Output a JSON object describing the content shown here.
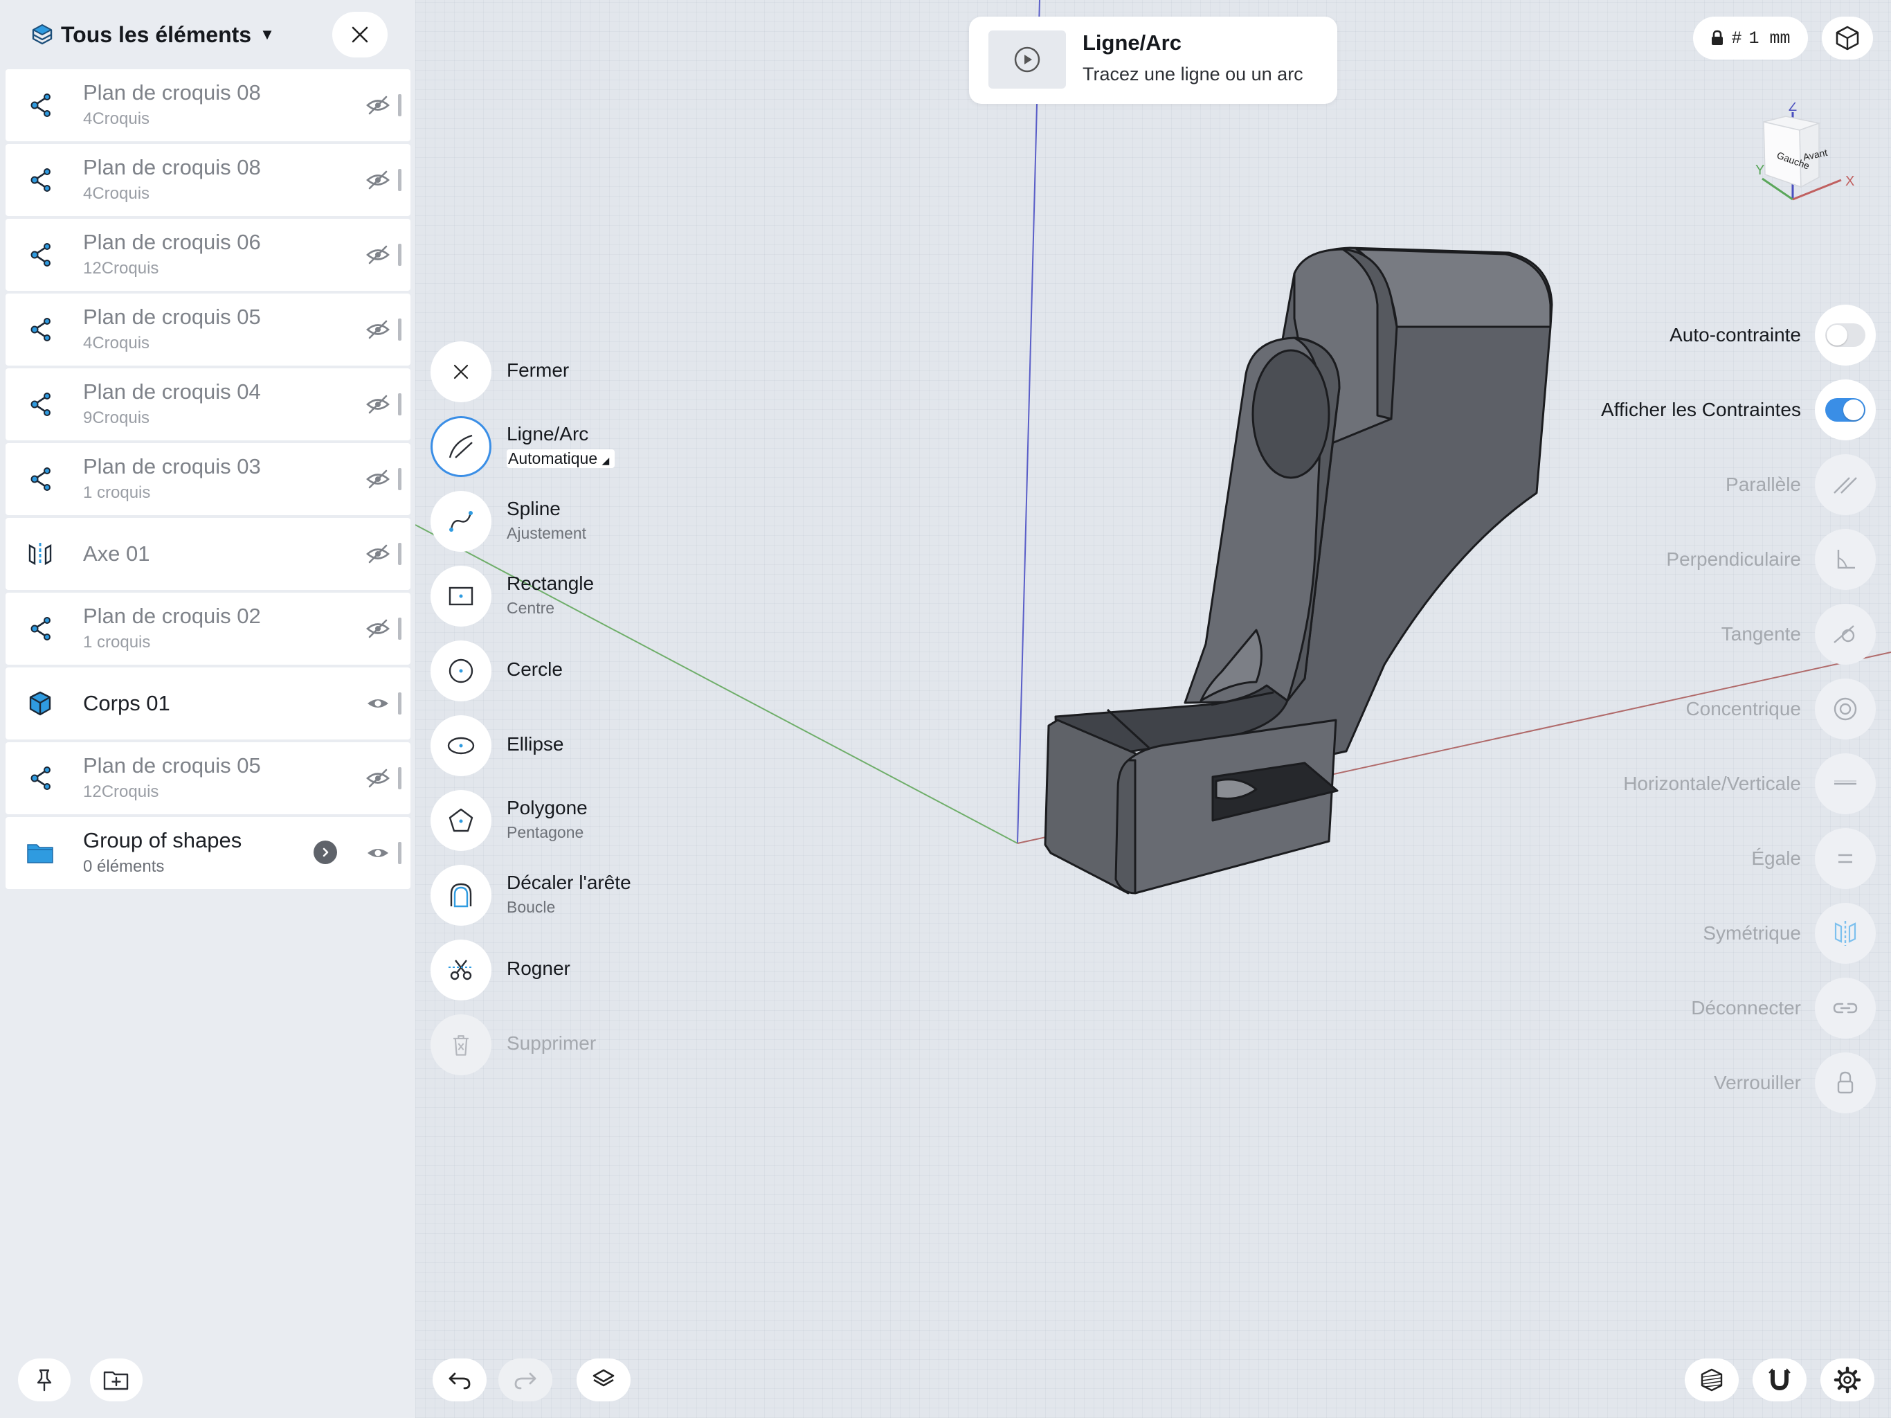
{
  "sidebar": {
    "title": "Tous les éléments",
    "items": [
      {
        "name": "Plan de croquis 08",
        "sub": "4Croquis",
        "type": "sketch",
        "visible": false
      },
      {
        "name": "Plan de croquis 08",
        "sub": "4Croquis",
        "type": "sketch",
        "visible": false
      },
      {
        "name": "Plan de croquis 06",
        "sub": "12Croquis",
        "type": "sketch",
        "visible": false
      },
      {
        "name": "Plan de croquis 05",
        "sub": "4Croquis",
        "type": "sketch",
        "visible": false
      },
      {
        "name": "Plan de croquis 04",
        "sub": "9Croquis",
        "type": "sketch",
        "visible": false
      },
      {
        "name": "Plan de croquis 03",
        "sub": "1 croquis",
        "type": "sketch",
        "visible": false
      },
      {
        "name": "Axe 01",
        "sub": "",
        "type": "axis",
        "visible": false
      },
      {
        "name": "Plan de croquis 02",
        "sub": "1 croquis",
        "type": "sketch",
        "visible": false
      },
      {
        "name": "Corps 01",
        "sub": "",
        "type": "body",
        "visible": true
      },
      {
        "name": "Plan de croquis 05",
        "sub": "12Croquis",
        "type": "sketch",
        "visible": false
      },
      {
        "name": "Group of shapes",
        "sub": "0 éléments",
        "type": "group",
        "visible": true
      }
    ]
  },
  "tools": [
    {
      "label": "Fermer",
      "sub": "",
      "icon": "close-icon"
    },
    {
      "label": "Ligne/Arc",
      "sub": "Automatique",
      "icon": "line-arc-icon",
      "active": true
    },
    {
      "label": "Spline",
      "sub": "Ajustement",
      "icon": "spline-icon"
    },
    {
      "label": "Rectangle",
      "sub": "Centre",
      "icon": "rectangle-icon"
    },
    {
      "label": "Cercle",
      "sub": "",
      "icon": "circle-icon"
    },
    {
      "label": "Ellipse",
      "sub": "",
      "icon": "ellipse-icon"
    },
    {
      "label": "Polygone",
      "sub": "Pentagone",
      "icon": "polygon-icon"
    },
    {
      "label": "Décaler l'arête",
      "sub": "Boucle",
      "icon": "offset-edge-icon"
    },
    {
      "label": "Rogner",
      "sub": "",
      "icon": "trim-icon"
    },
    {
      "label": "Supprimer",
      "sub": "",
      "icon": "delete-icon",
      "disabled": true
    }
  ],
  "tooltip": {
    "title": "Ligne/Arc",
    "description": "Tracez une ligne ou un arc"
  },
  "units": {
    "symbol": "#",
    "value": "1 mm"
  },
  "navcube": {
    "z": "Z",
    "y": "Y",
    "x": "X",
    "face_left": "Gauche",
    "face_front": "Avant"
  },
  "constraints": [
    {
      "label": "Auto-contrainte",
      "kind": "toggle",
      "on": false
    },
    {
      "label": "Afficher les Contraintes",
      "kind": "toggle",
      "on": true
    },
    {
      "label": "Parallèle",
      "kind": "button",
      "icon": "parallel-icon"
    },
    {
      "label": "Perpendiculaire",
      "kind": "button",
      "icon": "perpendicular-icon"
    },
    {
      "label": "Tangente",
      "kind": "button",
      "icon": "tangent-icon"
    },
    {
      "label": "Concentrique",
      "kind": "button",
      "icon": "concentric-icon"
    },
    {
      "label": "Horizontale/Verticale",
      "kind": "button",
      "icon": "horizontal-vertical-icon"
    },
    {
      "label": "Égale",
      "kind": "button",
      "icon": "equal-icon"
    },
    {
      "label": "Symétrique",
      "kind": "button",
      "icon": "symmetric-icon"
    },
    {
      "label": "Déconnecter",
      "kind": "button",
      "icon": "disconnect-icon"
    },
    {
      "label": "Verrouiller",
      "kind": "button",
      "icon": "lock-icon"
    }
  ],
  "colors": {
    "accent": "#3a8ee6",
    "model": "#6e7178",
    "axis_x": "#b06a6a",
    "axis_y": "#6fae6a",
    "axis_z": "#5a5ec8",
    "icon_blue": "#2f9be0"
  }
}
